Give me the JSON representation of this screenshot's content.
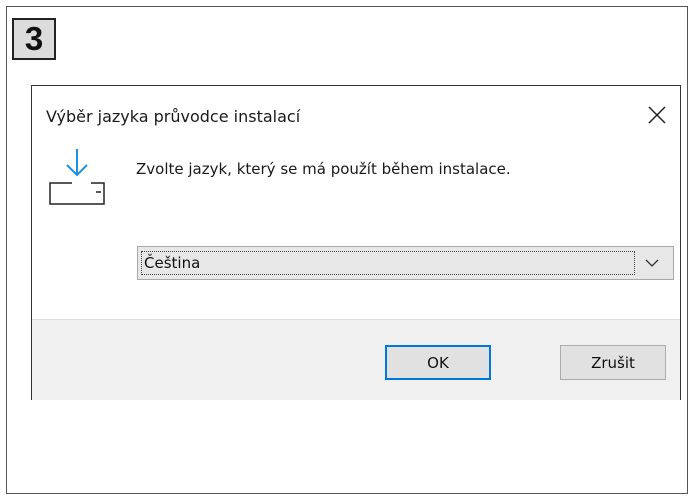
{
  "step_number": "3",
  "dialog": {
    "title": "Výběr jazyka průvodce instalací",
    "close_icon": "close-icon",
    "setup_icon": "install-download-icon",
    "message": "Zvolte jazyk, který se má použít během instalace.",
    "language_select": {
      "selected": "Čeština",
      "dropdown_icon": "chevron-down-icon"
    },
    "buttons": {
      "ok_label": "OK",
      "cancel_label": "Zrušit"
    }
  },
  "colors": {
    "accent": "#0078d7",
    "footer_bg": "#f0f0f0"
  }
}
